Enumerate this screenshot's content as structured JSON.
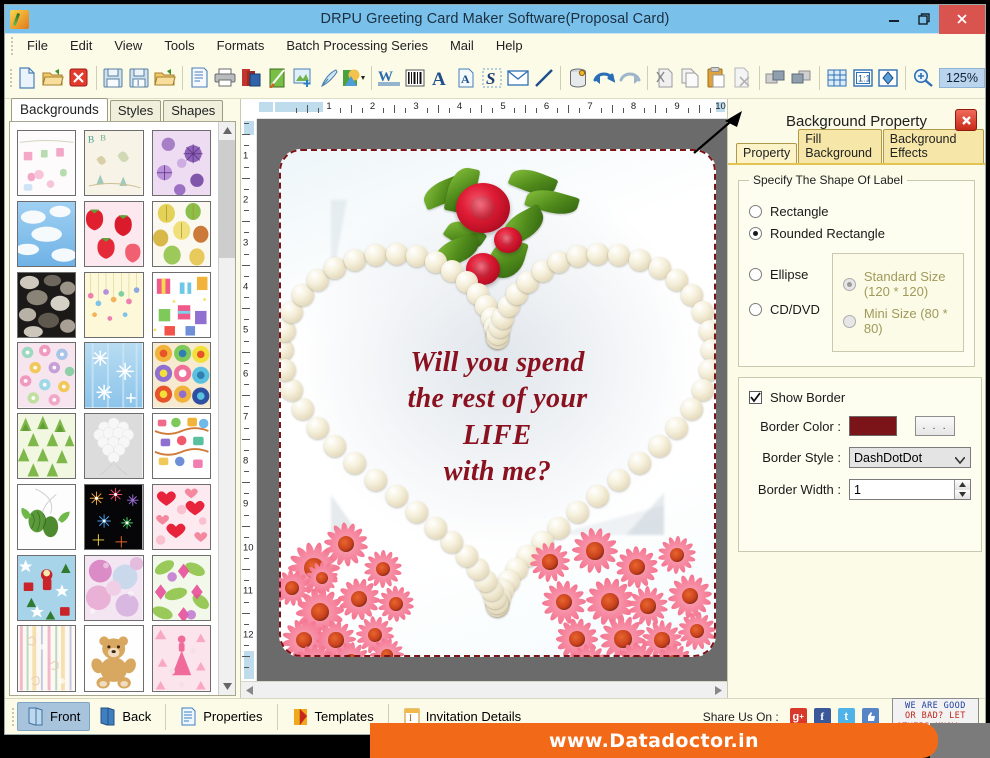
{
  "window": {
    "title": "DRPU Greeting Card Maker Software(Proposal Card)",
    "icon": "app-icon",
    "controls": {
      "minimize": "minimize-button",
      "restore": "restore-button",
      "close": "close-button"
    }
  },
  "menubar": {
    "items": [
      "File",
      "Edit",
      "View",
      "Tools",
      "Formats",
      "Batch Processing Series",
      "Mail",
      "Help"
    ]
  },
  "toolbar": {
    "zoom_level": "125%",
    "icons": [
      "new-document-icon",
      "open-folder-icon",
      "delete-red-x-icon",
      "save-icon",
      "save-as-icon",
      "open-template-icon",
      "page-setup-icon",
      "print-icon",
      "card-layers-icon",
      "paint-card-icon",
      "insert-image-icon",
      "pen-icon",
      "shape-gradient-icon",
      "watermark-icon",
      "barcode-icon",
      "text-bold-a-icon",
      "text-box-a-icon",
      "signature-s-icon",
      "email-icon",
      "line-tool-icon",
      "database-icon",
      "undo-icon",
      "redo-icon",
      "cut-icon",
      "copy-icon",
      "paste-icon",
      "paste-delete-icon",
      "bring-front-icon",
      "send-back-icon",
      "grid-icon",
      "actual-size-icon",
      "fit-page-icon",
      "zoom-in-icon"
    ]
  },
  "left_panel": {
    "tabs": [
      {
        "label": "Backgrounds",
        "active": true
      },
      {
        "label": "Styles",
        "active": false
      },
      {
        "label": "Shapes",
        "active": false
      }
    ],
    "scrollbar": {
      "up": "scroll-up-icon",
      "down": "scroll-down-icon"
    },
    "thumbnails": [
      "baby-clothesline-pink",
      "baby-storks-beige",
      "purple-floral-burst",
      "blue-sky-clouds",
      "red-strawberries",
      "autumn-leaves-pastel",
      "dark-pebbles-stones",
      "yellow-confetti-drops",
      "gift-boxes-colorful",
      "pastel-flower-mosaic",
      "blue-snowflakes",
      "circle-mandalas-bright",
      "green-pine-trees",
      "white-rose-heart-grey",
      "kids-toys-white",
      "green-pinecone-white",
      "fireworks-black",
      "red-hearts-pink",
      "santa-christmas-blue",
      "pink-bokeh-floral",
      "green-pink-petals",
      "pastel-stripes-swirls",
      "teddy-bear-white",
      "pink-princess-dress"
    ]
  },
  "canvas": {
    "h_ruler_marks": [
      "1",
      "2",
      "3",
      "4",
      "5",
      "6",
      "7",
      "8",
      "9",
      "10"
    ],
    "v_ruler_marks": [
      "1",
      "2",
      "3",
      "4",
      "5",
      "6",
      "7",
      "8",
      "9",
      "10",
      "11",
      "12"
    ],
    "card": {
      "lines": [
        "Will you spend",
        "the rest of your",
        "LIFE",
        "with me?"
      ],
      "text_color": "#8a1220",
      "border_color": "#7b1418",
      "shape": "Rounded Rectangle",
      "ornaments": [
        "pearl-heart",
        "red-roses-top",
        "pink-daisies-bottom"
      ]
    }
  },
  "right_panel": {
    "title": "Background Property",
    "close_icon": "panel-close-icon",
    "tabs": [
      {
        "label": "Property",
        "active": true
      },
      {
        "label": "Fill Background",
        "active": false
      },
      {
        "label": "Background Effects",
        "active": false
      }
    ],
    "shape_group": {
      "legend": "Specify The Shape Of Label",
      "options": [
        {
          "label": "Rectangle",
          "selected": false,
          "disabled": false
        },
        {
          "label": "Rounded Rectangle",
          "selected": true,
          "disabled": false
        },
        {
          "label": "Ellipse",
          "selected": false,
          "disabled": false
        },
        {
          "label": "CD/DVD",
          "selected": false,
          "disabled": false
        }
      ],
      "size_options": [
        {
          "label": "Standard Size (120 * 120)",
          "selected": true,
          "disabled": true
        },
        {
          "label": "Mini Size (80 * 80)",
          "selected": false,
          "disabled": true
        }
      ]
    },
    "border_group": {
      "show_border_label": "Show Border",
      "show_border_checked": true,
      "color_label": "Border Color :",
      "color_value": "#7b1418",
      "color_button_label": ". . .",
      "style_label": "Border Style :",
      "style_value": "DashDotDot",
      "width_label": "Border Width :",
      "width_value": "1"
    }
  },
  "bottom_bar": {
    "items": [
      {
        "label": "Front",
        "icon": "card-front-icon",
        "active": true
      },
      {
        "label": "Back",
        "icon": "card-back-icon",
        "active": false
      },
      {
        "label": "Properties",
        "icon": "properties-icon",
        "active": false
      },
      {
        "label": "Templates",
        "icon": "templates-icon",
        "active": false
      },
      {
        "label": "Invitation Details",
        "icon": "invitation-details-icon",
        "active": false
      }
    ],
    "share_label": "Share Us On :",
    "share_icons": [
      "google-plus-icon",
      "facebook-icon",
      "twitter-icon",
      "thumbs-up-icon"
    ],
    "feedback_lines": [
      "WE ARE GOOD",
      "OR BAD? LET",
      "OTHERS KNOW..."
    ]
  },
  "banner": {
    "url": "www.Datadoctor.in",
    "color": "#f26a17"
  }
}
